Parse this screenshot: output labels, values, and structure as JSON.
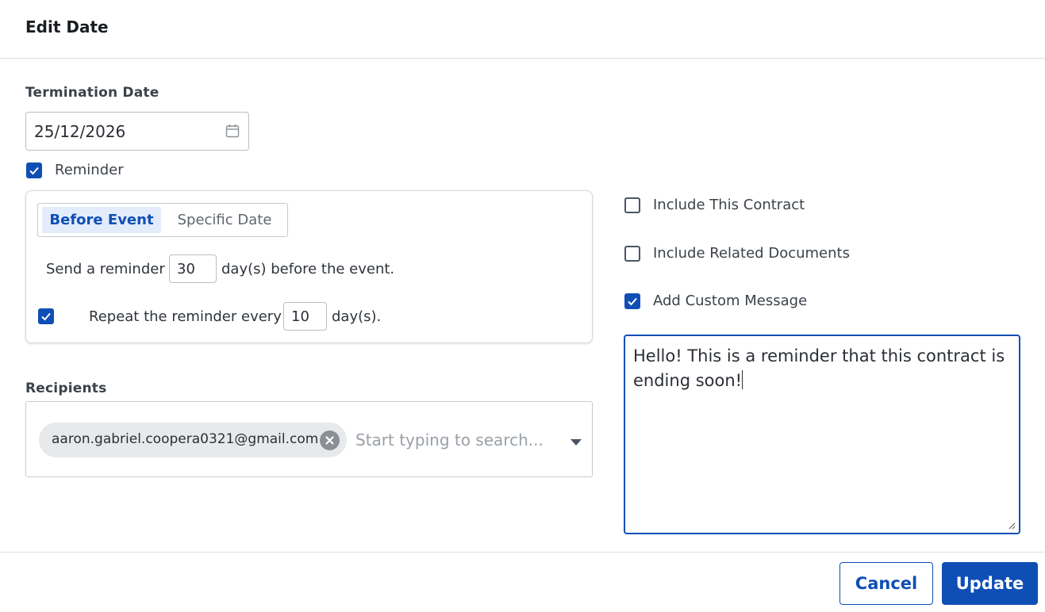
{
  "dialog": {
    "title": "Edit Date"
  },
  "termination": {
    "label": "Termination Date",
    "value": "25/12/2026",
    "icon": "calendar-icon"
  },
  "reminder": {
    "label": "Reminder",
    "checked": true,
    "tabs": [
      {
        "label": "Before Event",
        "active": true
      },
      {
        "label": "Specific Date",
        "active": false
      }
    ],
    "send_prefix": "Send a reminder",
    "days_before": "30",
    "send_suffix": "day(s) before the event.",
    "repeat_checked": true,
    "repeat_prefix": "Repeat the reminder every",
    "repeat_days": "10",
    "repeat_suffix": "day(s)."
  },
  "options": {
    "include_contract": {
      "label": "Include This Contract",
      "checked": false
    },
    "include_related": {
      "label": "Include Related Documents",
      "checked": false
    },
    "custom_message": {
      "label": "Add Custom Message",
      "checked": true
    }
  },
  "message": {
    "text": "Hello! This is a reminder that this contract is ending soon!"
  },
  "recipients": {
    "label": "Recipients",
    "chips": [
      "aaron.gabriel.coopera0321@gmail.com"
    ],
    "placeholder": "Start typing to search..."
  },
  "footer": {
    "cancel_label": "Cancel",
    "update_label": "Update"
  },
  "colors": {
    "accent": "#0f4fb5",
    "active_tab_bg": "#e3ecfb",
    "chip_bg": "#e8e9eb"
  }
}
